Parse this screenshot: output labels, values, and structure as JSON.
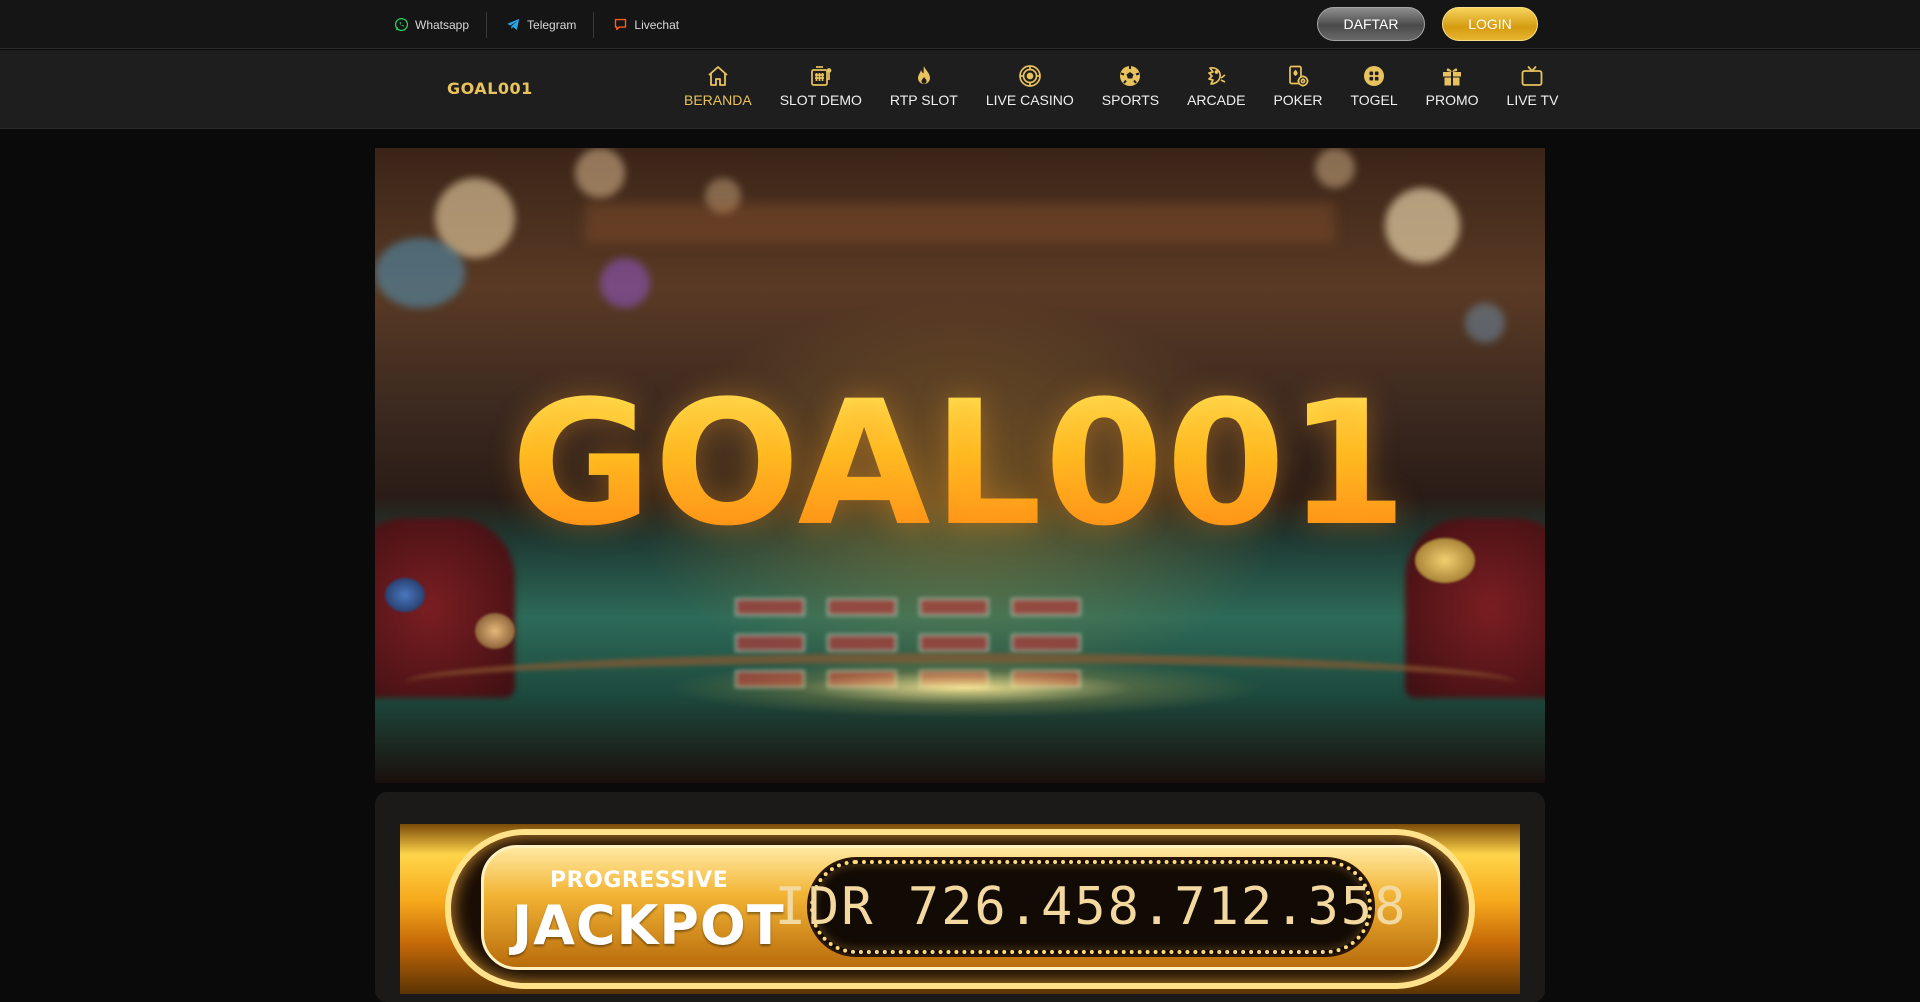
{
  "topbar": {
    "contacts": [
      {
        "label": "Whatsapp",
        "icon": "whatsapp-icon",
        "color": "#25d366"
      },
      {
        "label": "Telegram",
        "icon": "telegram-icon",
        "color": "#2aa3e0"
      },
      {
        "label": "Livechat",
        "icon": "chat-icon",
        "color": "#ff5a1f"
      }
    ],
    "register_label": "DAFTAR",
    "login_label": "LOGIN"
  },
  "header": {
    "logo": "GOAL001"
  },
  "nav": {
    "items": [
      {
        "label": "BERANDA",
        "icon": "home-icon",
        "active": true
      },
      {
        "label": "SLOT DEMO",
        "icon": "slot-machine-icon"
      },
      {
        "label": "RTP SLOT",
        "icon": "flame-icon"
      },
      {
        "label": "LIVE CASINO",
        "icon": "roulette-icon"
      },
      {
        "label": "SPORTS",
        "icon": "soccer-ball-icon"
      },
      {
        "label": "ARCADE",
        "icon": "fish-icon"
      },
      {
        "label": "POKER",
        "icon": "poker-cards-icon"
      },
      {
        "label": "TOGEL",
        "icon": "lottery-ball-icon"
      },
      {
        "label": "PROMO",
        "icon": "gift-icon"
      },
      {
        "label": "LIVE TV",
        "icon": "tv-icon"
      }
    ],
    "accent_color": "#e8c25c"
  },
  "banner": {
    "title": "GOAL001"
  },
  "jackpot": {
    "label_small": "PROGRESSIVE",
    "label_big": "JACKPOT",
    "amount": "IDR 726.458.712.358"
  }
}
